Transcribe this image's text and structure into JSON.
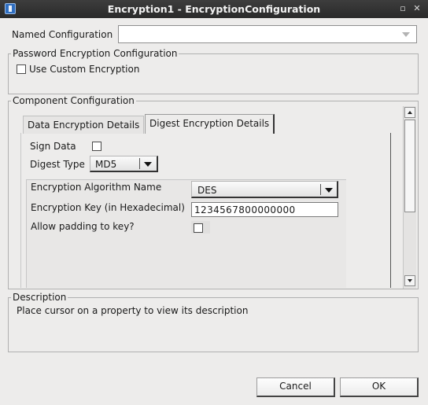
{
  "window": {
    "title": "Encryption1 - EncryptionConfiguration",
    "minimize": "▫",
    "close": "✕"
  },
  "named_configuration": {
    "label": "Named Configuration",
    "value": ""
  },
  "password_group": {
    "title": "Password Encryption Configuration",
    "custom_label": "Use Custom Encryption",
    "custom_checked": false
  },
  "component_group": {
    "title": "Component Configuration",
    "tabs": [
      {
        "label": "Data Encryption Details",
        "active": false
      },
      {
        "label": "Digest Encryption Details",
        "active": true
      }
    ],
    "sign_data": {
      "label": "Sign Data",
      "checked": false
    },
    "digest_type": {
      "label": "Digest Type",
      "value": "MD5"
    },
    "properties": {
      "algorithm": {
        "label": "Encryption Algorithm Name",
        "value": "DES"
      },
      "key": {
        "label": "Encryption Key (in Hexadecimal)",
        "value": "1234567800000000"
      },
      "padding": {
        "label": "Allow padding to key?",
        "checked": false
      }
    }
  },
  "description": {
    "title": "Description",
    "text": "Place cursor on a property to view its description"
  },
  "buttons": {
    "cancel": "Cancel",
    "ok": "OK"
  }
}
